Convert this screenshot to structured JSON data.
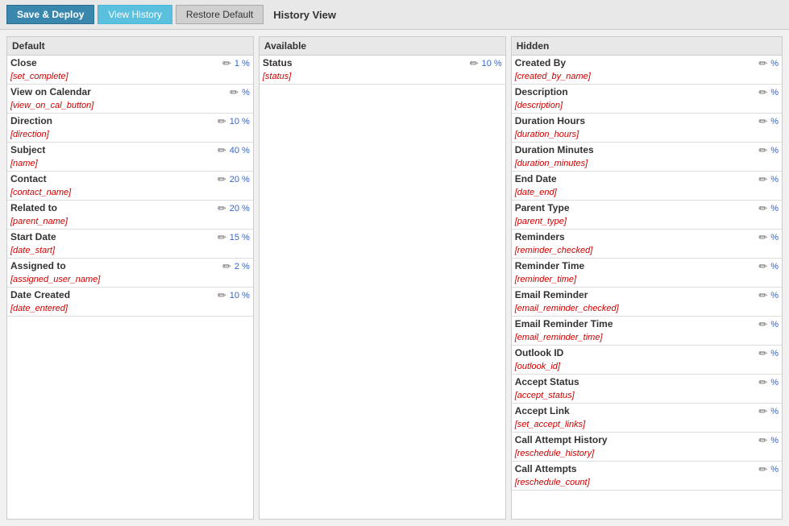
{
  "toolbar": {
    "save_deploy_label": "Save & Deploy",
    "view_history_label": "View History",
    "restore_default_label": "Restore Default",
    "history_view_label": "History View"
  },
  "columns": {
    "default": {
      "header": "Default",
      "fields": [
        {
          "label": "Close",
          "token": "[set_complete]",
          "percent": "1 %"
        },
        {
          "label": "View on Calendar",
          "token": "[view_on_cal_button]",
          "percent": "%"
        },
        {
          "label": "Direction",
          "token": "[direction]",
          "percent": "10 %"
        },
        {
          "label": "Subject",
          "token": "[name]",
          "percent": "40 %"
        },
        {
          "label": "Contact",
          "token": "[contact_name]",
          "percent": "20 %"
        },
        {
          "label": "Related to",
          "token": "[parent_name]",
          "percent": "20 %"
        },
        {
          "label": "Start Date",
          "token": "[date_start]",
          "percent": "15 %"
        },
        {
          "label": "Assigned to",
          "token": "[assigned_user_name]",
          "percent": "2 %"
        },
        {
          "label": "Date Created",
          "token": "[date_entered]",
          "percent": "10 %"
        }
      ]
    },
    "available": {
      "header": "Available",
      "fields": [
        {
          "label": "Status",
          "token": "[status]",
          "percent": "10 %"
        }
      ]
    },
    "hidden": {
      "header": "Hidden",
      "fields": [
        {
          "label": "Created By",
          "token": "[created_by_name]",
          "percent": "%"
        },
        {
          "label": "Description",
          "token": "[description]",
          "percent": "%"
        },
        {
          "label": "Duration Hours",
          "token": "[duration_hours]",
          "percent": "%"
        },
        {
          "label": "Duration Minutes",
          "token": "[duration_minutes]",
          "percent": "%"
        },
        {
          "label": "End Date",
          "token": "[date_end]",
          "percent": "%"
        },
        {
          "label": "Parent Type",
          "token": "[parent_type]",
          "percent": "%"
        },
        {
          "label": "Reminders",
          "token": "[reminder_checked]",
          "percent": "%"
        },
        {
          "label": "Reminder Time",
          "token": "[reminder_time]",
          "percent": "%"
        },
        {
          "label": "Email Reminder",
          "token": "[email_reminder_checked]",
          "percent": "%"
        },
        {
          "label": "Email Reminder Time",
          "token": "[email_reminder_time]",
          "percent": "%"
        },
        {
          "label": "Outlook ID",
          "token": "[outlook_id]",
          "percent": "%"
        },
        {
          "label": "Accept Status",
          "token": "[accept_status]",
          "percent": "%"
        },
        {
          "label": "Accept Link",
          "token": "[set_accept_links]",
          "percent": "%"
        },
        {
          "label": "Call Attempt History",
          "token": "[reschedule_history]",
          "percent": "%"
        },
        {
          "label": "Call Attempts",
          "token": "[reschedule_count]",
          "percent": "%"
        }
      ]
    }
  },
  "icons": {
    "edit": "✏"
  }
}
